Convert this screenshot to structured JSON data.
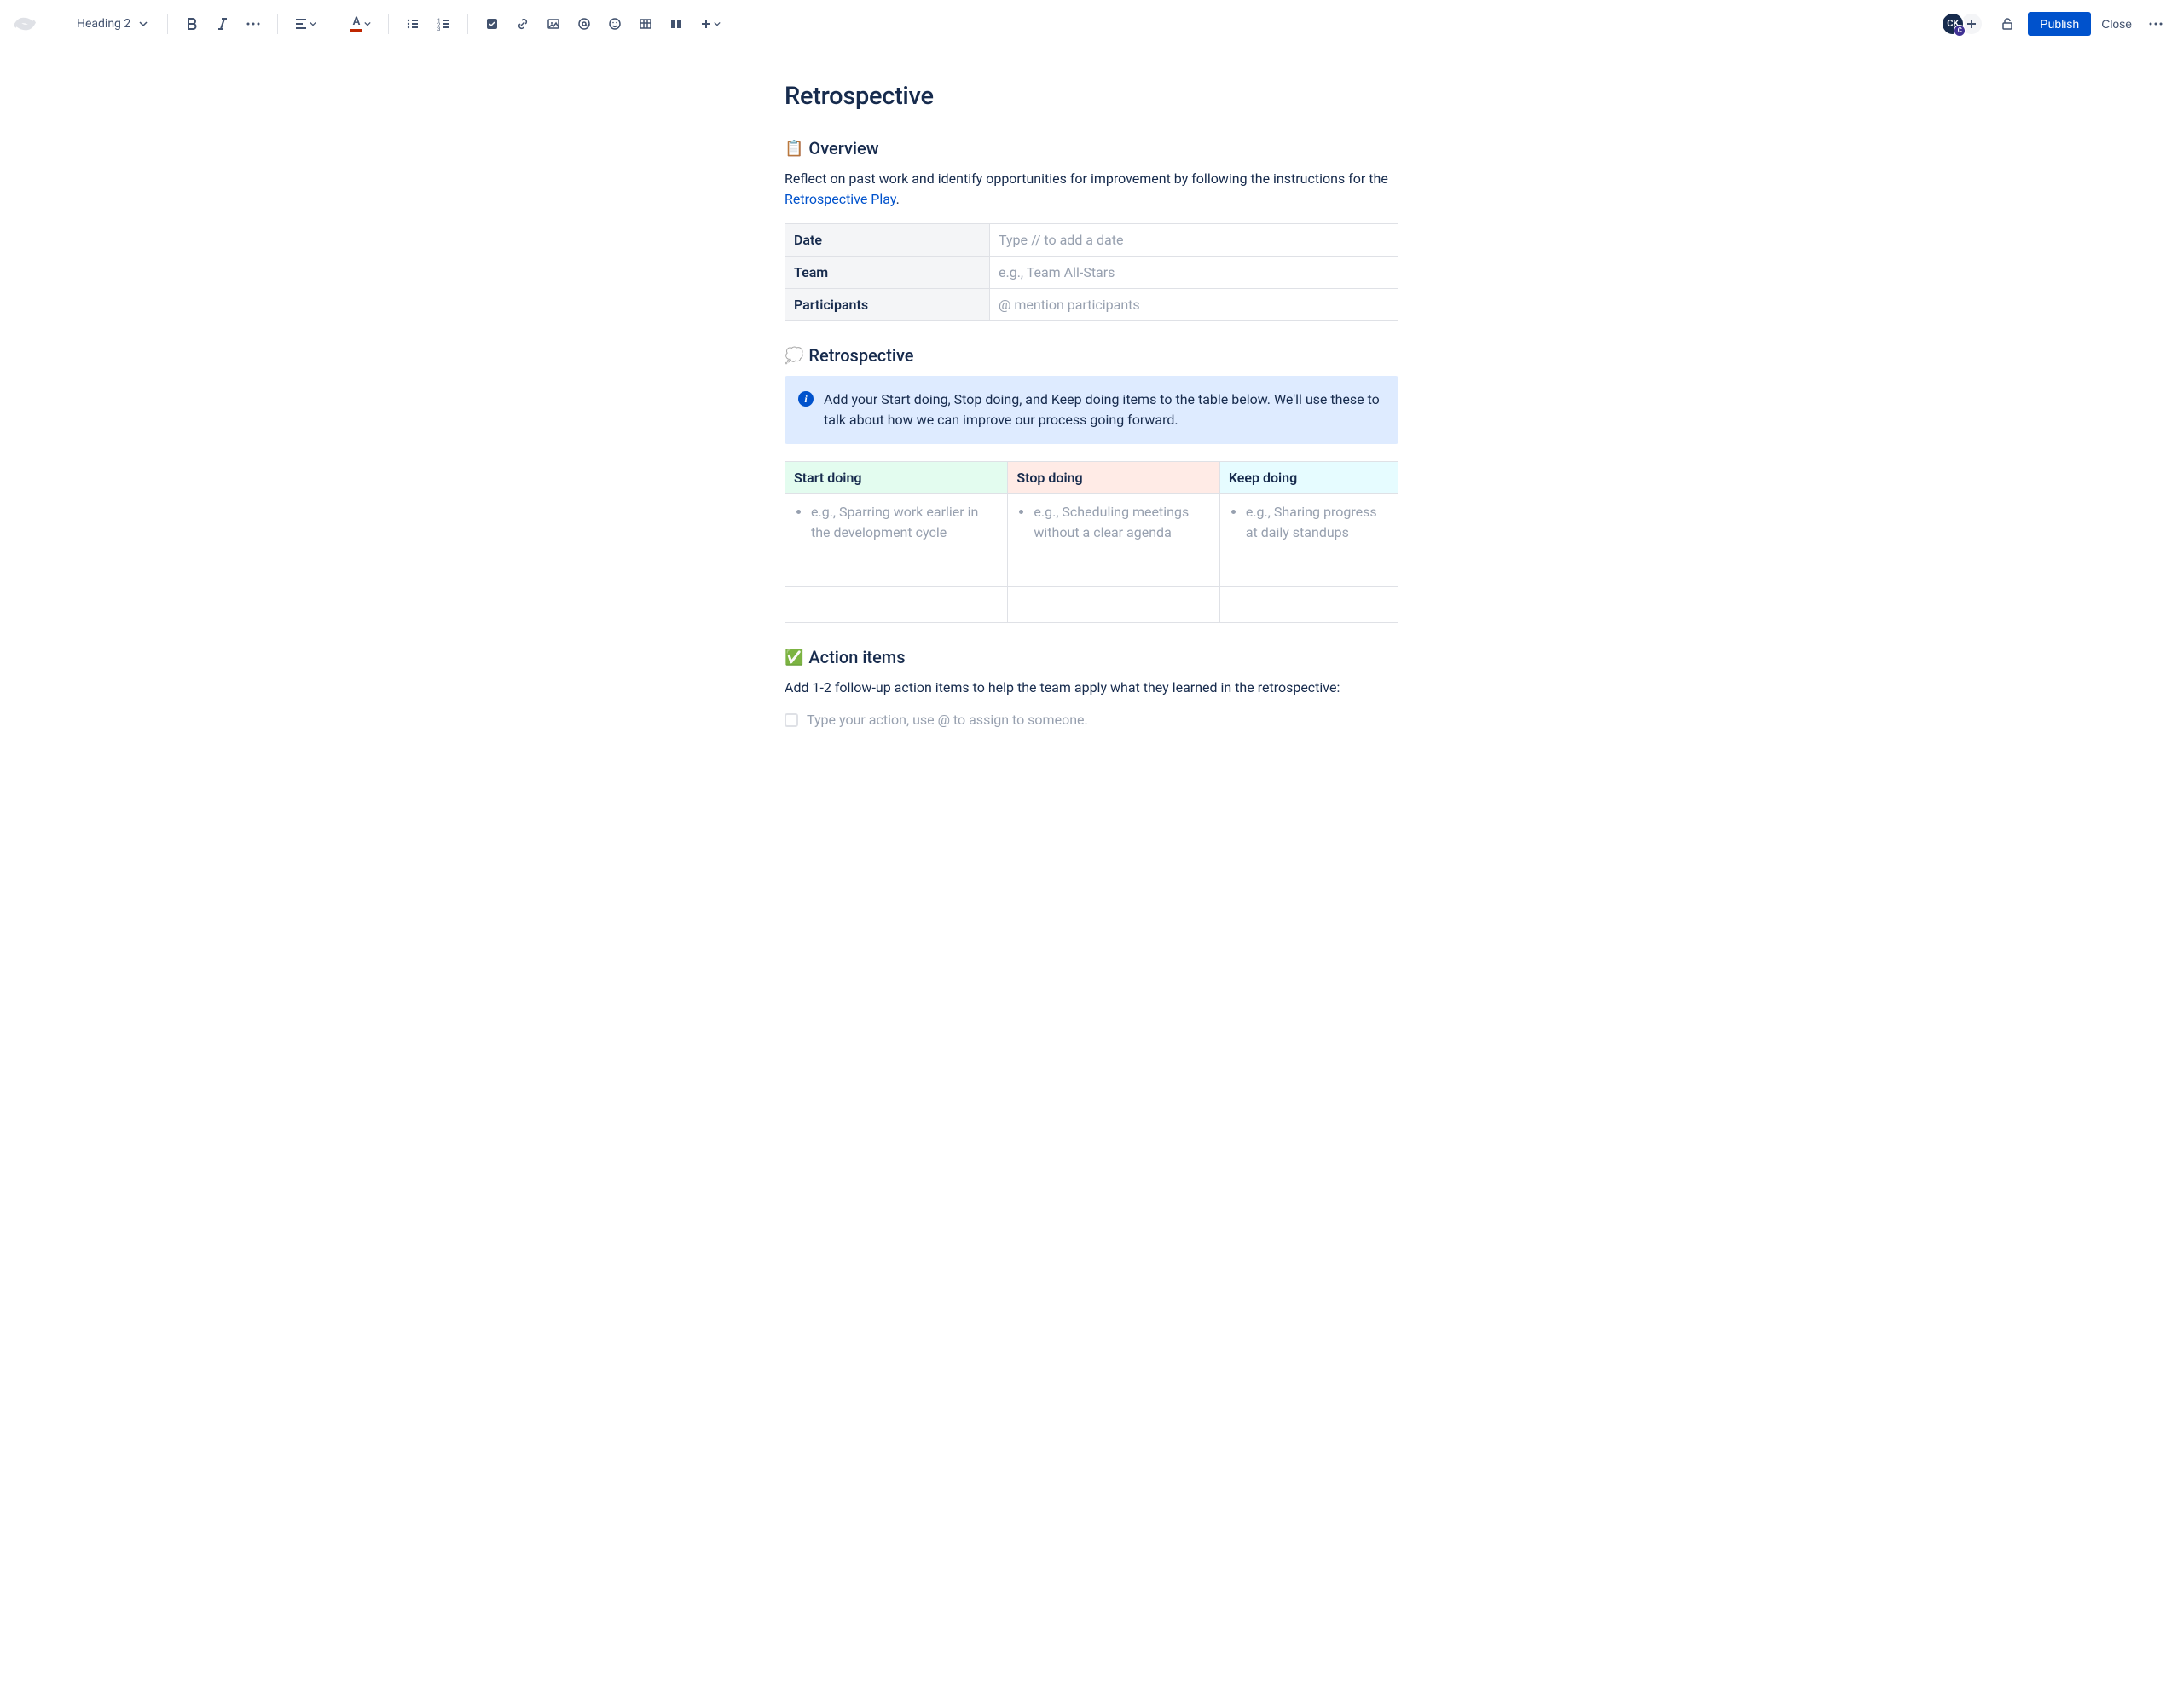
{
  "toolbar": {
    "style_select": "Heading 2",
    "publish_label": "Publish",
    "close_label": "Close",
    "avatar_initials": "CK",
    "avatar_badge": "C"
  },
  "page": {
    "title": "Retrospective"
  },
  "overview": {
    "emoji": "📋",
    "heading": "Overview",
    "intro_prefix": "Reflect on past work and identify opportunities for improvement by following the instructions for the ",
    "link_text": "Retrospective Play",
    "intro_suffix": ".",
    "table": {
      "rows": [
        {
          "label": "Date",
          "placeholder": "Type // to add a date"
        },
        {
          "label": "Team",
          "placeholder": "e.g., Team All-Stars"
        },
        {
          "label": "Participants",
          "placeholder": "@ mention participants"
        }
      ]
    }
  },
  "retro": {
    "emoji": "💭",
    "heading": "Retrospective",
    "info_text": "Add your Start doing, Stop doing, and Keep doing items to the table below. We'll use these to talk about how we can improve our process going forward.",
    "columns": {
      "start": {
        "header": "Start doing",
        "example": "e.g., Sparring work earlier in the development cycle"
      },
      "stop": {
        "header": "Stop doing",
        "example": "e.g., Scheduling meetings without a clear agenda"
      },
      "keep": {
        "header": "Keep doing",
        "example": "e.g., Sharing progress at daily standups"
      }
    }
  },
  "actions": {
    "emoji": "✅",
    "heading": "Action items",
    "intro": "Add 1-2 follow-up action items to help the team apply what they learned in the retrospective:",
    "placeholder": "Type your action, use @ to assign to someone."
  }
}
